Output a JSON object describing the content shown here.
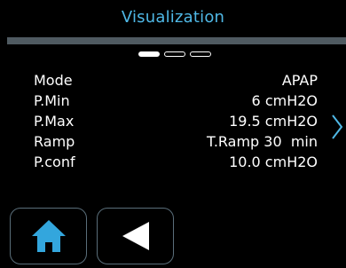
{
  "header": {
    "title": "Visualization"
  },
  "pager": {
    "pages": 3,
    "active_index": 0
  },
  "settings": [
    {
      "label": "Mode",
      "value": "APAP"
    },
    {
      "label": "P.Min",
      "value": "6 cmH2O"
    },
    {
      "label": "P.Max",
      "value": "19.5 cmH2O"
    },
    {
      "label": "Ramp",
      "value": "T.Ramp 30  min"
    },
    {
      "label": "P.conf",
      "value": "10.0 cmH2O"
    }
  ],
  "icons": {
    "next": "chevron-right-icon",
    "home": "home-icon",
    "back": "back-triangle-icon"
  },
  "colors": {
    "accent": "#4fb8e6",
    "background": "#000000",
    "divider": "#4f5a61",
    "button_border": "#5a6e7a",
    "text": "#ffffff"
  }
}
